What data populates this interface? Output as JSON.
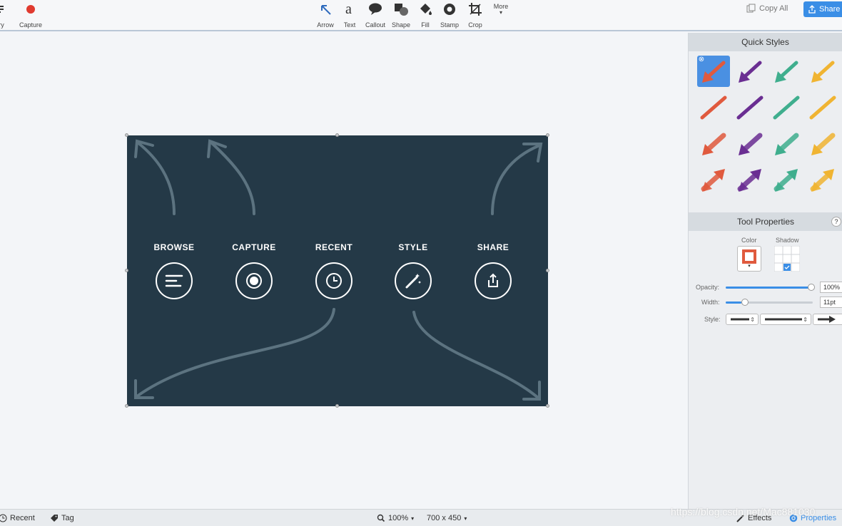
{
  "toolbar": {
    "left_items": [
      {
        "label": "rary",
        "icon": "library-icon"
      },
      {
        "label": "Capture",
        "icon": "record-icon"
      }
    ],
    "tools": [
      {
        "label": "Arrow",
        "icon": "arrow-tool-icon"
      },
      {
        "label": "Text",
        "icon": "text-tool-icon",
        "glyph": "a"
      },
      {
        "label": "Callout",
        "icon": "callout-icon"
      },
      {
        "label": "Shape",
        "icon": "shape-icon"
      },
      {
        "label": "Fill",
        "icon": "fill-icon"
      },
      {
        "label": "Stamp",
        "icon": "stamp-icon"
      },
      {
        "label": "Crop",
        "icon": "crop-icon"
      }
    ],
    "more_label": "More",
    "copy_all_label": "Copy All",
    "share_label": "Share"
  },
  "canvas": {
    "items": [
      {
        "label": "BROWSE",
        "icon": "browse-list-icon"
      },
      {
        "label": "CAPTURE",
        "icon": "capture-record-icon"
      },
      {
        "label": "RECENT",
        "icon": "clock-icon"
      },
      {
        "label": "STYLE",
        "icon": "magic-wand-icon"
      },
      {
        "label": "SHARE",
        "icon": "share-icon"
      }
    ]
  },
  "sidebar": {
    "quick_styles_title": "Quick Styles",
    "quick_style_colors": [
      "#e05a3e",
      "#6a2e92",
      "#3fae8e",
      "#f0b432"
    ],
    "tool_properties_title": "Tool Properties",
    "help_label": "?",
    "color_label": "Color",
    "shadow_label": "Shadow",
    "opacity_label": "Opacity:",
    "opacity_value": "100%",
    "opacity_fraction": 1.0,
    "width_label": "Width:",
    "width_value": "11pt",
    "style_label": "Style:"
  },
  "statusbar": {
    "recent_label": "Recent",
    "tag_label": "Tag",
    "zoom_value": "100%",
    "dimensions": "700 x 450",
    "effects_label": "Effects",
    "properties_label": "Properties"
  },
  "watermark": "https://blog.csdn.net/Mac881030",
  "colors": {
    "accent": "#3a8ee6",
    "canvas_image_bg": "#243947",
    "record_red": "#e03a2f"
  }
}
